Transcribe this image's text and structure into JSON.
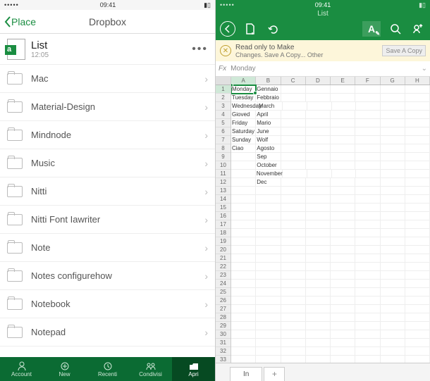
{
  "left": {
    "status": {
      "signal": "•••••",
      "wifi": "wifi",
      "time": "09:41",
      "battery": "batt"
    },
    "back_label": "Place",
    "nav_title": "Dropbox",
    "file": {
      "name": "List",
      "time": "12:05"
    },
    "folders": [
      "Mac",
      "Material-Design",
      "Mindnode",
      "Music",
      "Nitti",
      "Nitti Font Iawriter",
      "Note",
      "Notes configurehow",
      "Notebook",
      "Notepad"
    ],
    "bottom": [
      {
        "label": "Account"
      },
      {
        "label": "New"
      },
      {
        "label": "Recenti"
      },
      {
        "label": "Condivisi"
      },
      {
        "label": "Apri"
      }
    ]
  },
  "right": {
    "status": {
      "signal": "•••••",
      "time": "09:41"
    },
    "doc_title": "List",
    "banner": {
      "title": "Read only to Make",
      "subtitle": "Changes. Save A Copy... Other",
      "button": "Save A Copy"
    },
    "fx_label": "Fx",
    "fx_value": "Monday",
    "columns": [
      "A",
      "B",
      "C",
      "D",
      "E",
      "F",
      "G",
      "H"
    ],
    "rows": [
      [
        "Monday",
        "Gennaio",
        "",
        "",
        "",
        "",
        "",
        ""
      ],
      [
        "Tuesday",
        "Febbraio",
        "",
        "",
        "",
        "",
        "",
        ""
      ],
      [
        "Wednesday",
        "March",
        "",
        "",
        "",
        "",
        "",
        ""
      ],
      [
        "Gioved",
        "April",
        "",
        "",
        "",
        "",
        "",
        ""
      ],
      [
        "Friday",
        "Mario",
        "",
        "",
        "",
        "",
        "",
        ""
      ],
      [
        "Saturday",
        "June",
        "",
        "",
        "",
        "",
        "",
        ""
      ],
      [
        "Sunday",
        "Wolf",
        "",
        "",
        "",
        "",
        "",
        ""
      ],
      [
        "Ciao",
        "Agosto",
        "",
        "",
        "",
        "",
        "",
        ""
      ],
      [
        "",
        "Sep",
        "",
        "",
        "",
        "",
        "",
        ""
      ],
      [
        "",
        "October",
        "",
        "",
        "",
        "",
        "",
        ""
      ],
      [
        "",
        "November",
        "",
        "",
        "",
        "",
        "",
        ""
      ],
      [
        "",
        "Dec",
        "",
        "",
        "",
        "",
        "",
        ""
      ]
    ],
    "row_count": 35,
    "selected_cell": "A1",
    "sheet_tab": "In",
    "sheet_add": "+"
  }
}
